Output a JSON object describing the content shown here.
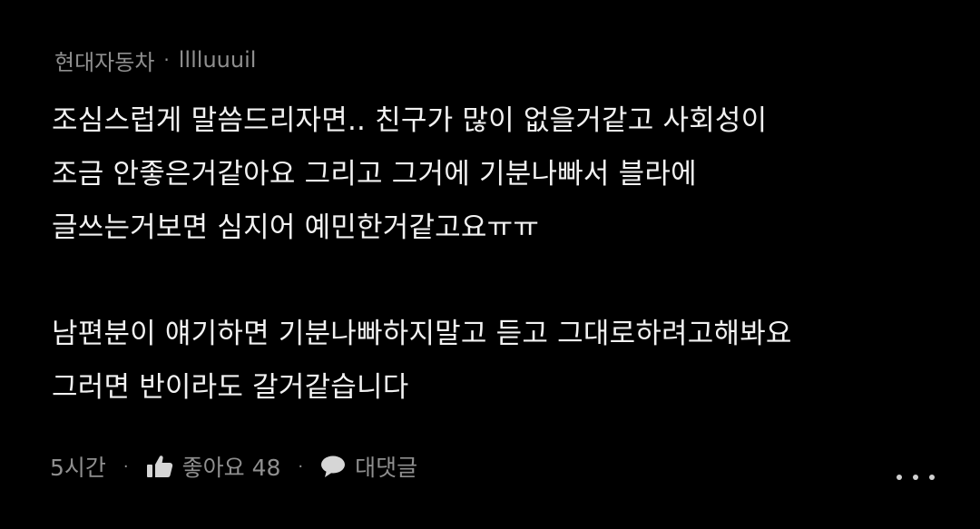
{
  "comment": {
    "company": "현대자동차",
    "separator": "·",
    "author": "lllluuuil",
    "paragraphs": [
      [
        "조심스럽게 말씀드리자면.. 친구가 많이 없을거같고 사회성이",
        "조금 안좋은거같아요 그리고 그거에 기분나빠서 블라에",
        "글쓰는거보면 심지어 예민한거같고요ㅠㅠ"
      ],
      [
        "남편분이 얘기하면 기분나빠하지말고 듣고 그대로하려고해봐요",
        "그러면 반이라도 갈거같습니다"
      ]
    ],
    "footer": {
      "time": "5시간",
      "separator": "·",
      "like_label": "좋아요 48",
      "reply_label": "대댓글"
    }
  },
  "colors": {
    "background": "#000000",
    "meta_text": "#8f8f8f",
    "body_text": "#f2f2f2",
    "more_dots": "#d0d0d0"
  },
  "icons": {
    "like": "thumbs-up-icon",
    "reply": "speech-bubble-icon",
    "more": "more-dots-icon"
  }
}
